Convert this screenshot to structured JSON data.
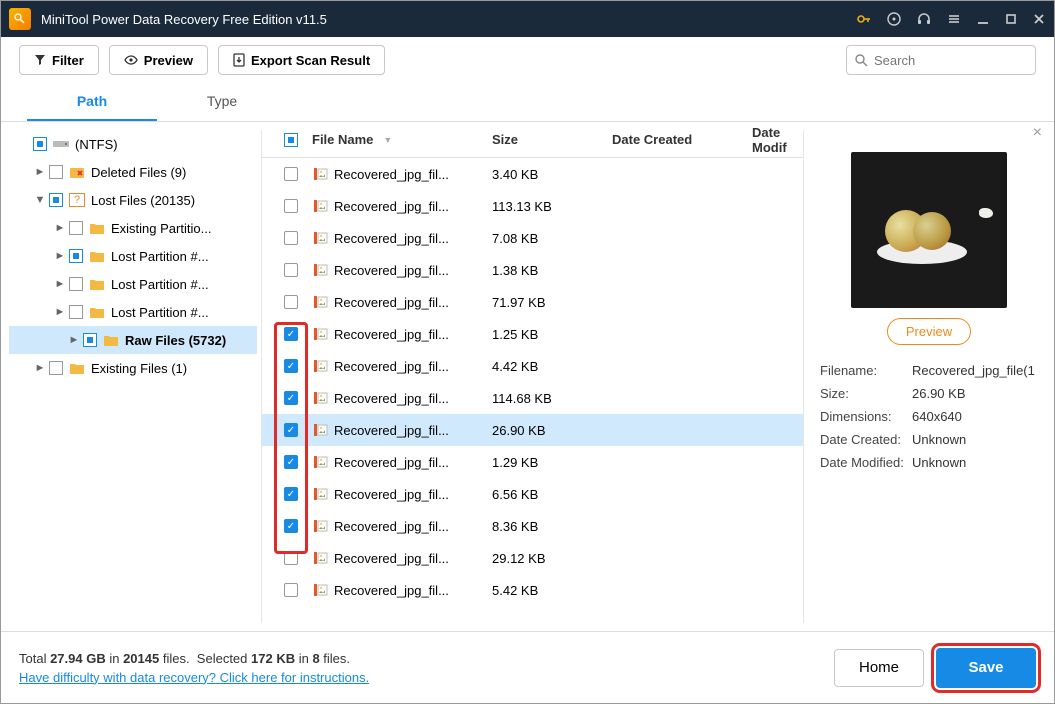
{
  "window_title": "MiniTool Power Data Recovery Free Edition v11.5",
  "toolbar": {
    "filter_label": "Filter",
    "preview_label": "Preview",
    "export_label": "Export Scan Result",
    "search_placeholder": "Search"
  },
  "tabs": [
    "Path",
    "Type"
  ],
  "active_tab": 0,
  "tree": [
    {
      "depth": 0,
      "chev": "",
      "cb": "ind",
      "icon": "drive",
      "label": "(NTFS)"
    },
    {
      "depth": 1,
      "chev": "►",
      "cb": "",
      "icon": "red-x",
      "label": "Deleted Files (9)"
    },
    {
      "depth": 1,
      "chev": "▼",
      "cb": "ind",
      "icon": "qmark",
      "label": "Lost Files (20135)"
    },
    {
      "depth": 2,
      "chev": "►",
      "cb": "",
      "icon": "folder",
      "label": "Existing Partitio..."
    },
    {
      "depth": 2,
      "chev": "►",
      "cb": "ind",
      "icon": "folder",
      "label": "Lost Partition #..."
    },
    {
      "depth": 2,
      "chev": "►",
      "cb": "",
      "icon": "folder",
      "label": "Lost Partition #..."
    },
    {
      "depth": 2,
      "chev": "►",
      "cb": "",
      "icon": "folder",
      "label": "Lost Partition #..."
    },
    {
      "depth": 3,
      "chev": "►",
      "cb": "ind",
      "icon": "folder",
      "label": "Raw Files (5732)",
      "sel": true
    },
    {
      "depth": 1,
      "chev": "►",
      "cb": "",
      "icon": "folder",
      "label": "Existing Files (1)"
    }
  ],
  "columns": [
    "File Name",
    "Size",
    "Date Created",
    "Date Modif"
  ],
  "files": [
    {
      "chk": false,
      "name": "Recovered_jpg_fil...",
      "size": "3.40 KB"
    },
    {
      "chk": false,
      "name": "Recovered_jpg_fil...",
      "size": "113.13 KB"
    },
    {
      "chk": false,
      "name": "Recovered_jpg_fil...",
      "size": "7.08 KB"
    },
    {
      "chk": false,
      "name": "Recovered_jpg_fil...",
      "size": "1.38 KB"
    },
    {
      "chk": false,
      "name": "Recovered_jpg_fil...",
      "size": "71.97 KB"
    },
    {
      "chk": true,
      "name": "Recovered_jpg_fil...",
      "size": "1.25 KB"
    },
    {
      "chk": true,
      "name": "Recovered_jpg_fil...",
      "size": "4.42 KB"
    },
    {
      "chk": true,
      "name": "Recovered_jpg_fil...",
      "size": "114.68 KB"
    },
    {
      "chk": true,
      "name": "Recovered_jpg_fil...",
      "size": "26.90 KB",
      "sel": true
    },
    {
      "chk": true,
      "name": "Recovered_jpg_fil...",
      "size": "1.29 KB"
    },
    {
      "chk": true,
      "name": "Recovered_jpg_fil...",
      "size": "6.56 KB"
    },
    {
      "chk": true,
      "name": "Recovered_jpg_fil...",
      "size": "8.36 KB"
    },
    {
      "chk": false,
      "name": "Recovered_jpg_fil...",
      "size": "29.12 KB"
    },
    {
      "chk": false,
      "name": "Recovered_jpg_fil...",
      "size": "5.42 KB"
    }
  ],
  "preview": {
    "button_label": "Preview",
    "meta": [
      {
        "k": "Filename:",
        "v": "Recovered_jpg_file(1"
      },
      {
        "k": "Size:",
        "v": "26.90 KB"
      },
      {
        "k": "Dimensions:",
        "v": "640x640"
      },
      {
        "k": "Date Created:",
        "v": "Unknown"
      },
      {
        "k": "Date Modified:",
        "v": "Unknown"
      }
    ]
  },
  "footer": {
    "total_size": "27.94 GB",
    "total_files": "20145",
    "sel_size": "172 KB",
    "sel_files": "8",
    "help_link": "Have difficulty with data recovery? Click here for instructions.",
    "home_label": "Home",
    "save_label": "Save"
  }
}
